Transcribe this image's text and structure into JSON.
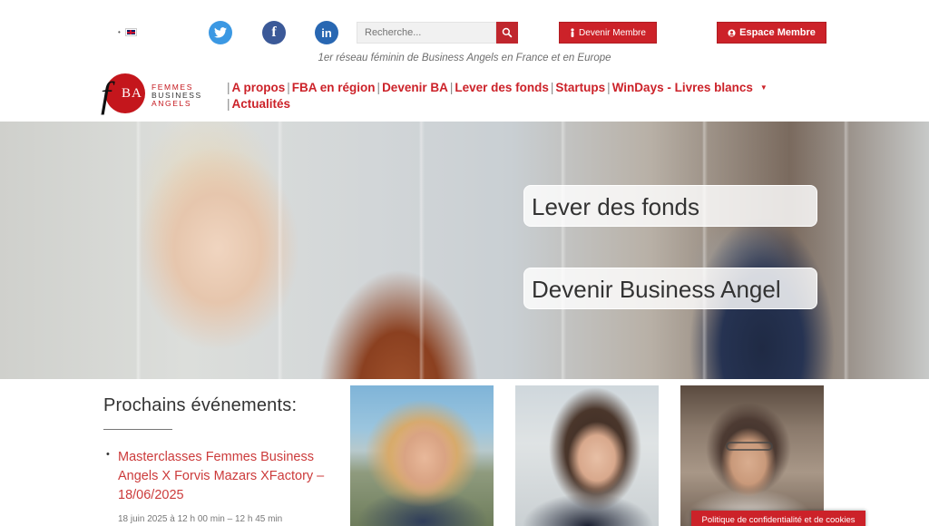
{
  "header": {
    "language_label": "•",
    "social": [
      {
        "name": "twitter",
        "icon": "twitter-icon",
        "color": "#3b98e3"
      },
      {
        "name": "facebook",
        "icon": "facebook-icon",
        "glyph": "f",
        "color": "#3b5998"
      },
      {
        "name": "linkedin",
        "icon": "linkedin-icon",
        "glyph": "in",
        "color": "#2867b2"
      }
    ],
    "search": {
      "placeholder": "Recherche...",
      "icon": "search-icon"
    },
    "become_member_label": "Devenir Membre",
    "member_space_label": "Espace Membre",
    "tagline": "1er réseau féminin de Business Angels en France et en Europe"
  },
  "logo": {
    "initial": "f",
    "initials": "BA",
    "line1": "FEMMES",
    "line2": "BUSINESS",
    "line3": "ANGELS"
  },
  "nav": {
    "items": [
      "A propos",
      "FBA en région",
      "Devenir BA",
      "Lever des fonds",
      "Startups",
      "WinDays - Livres blancs",
      "Actualités"
    ]
  },
  "hero": {
    "cta_primary": "Lever des fonds",
    "cta_secondary": "Devenir Business Angel"
  },
  "events": {
    "heading": "Prochains événements:",
    "items": [
      {
        "title": "Masterclasses Femmes Business Angels X Forvis Mazars XFactory – 18/06/2025",
        "date": "18 juin 2025 à 12 h 00 min – 12 h 45 min"
      }
    ]
  },
  "cookie_notice": "Politique de confidentialité et de cookies",
  "colors": {
    "brand_red": "#cc2229",
    "accent_search": "#c0262d"
  }
}
